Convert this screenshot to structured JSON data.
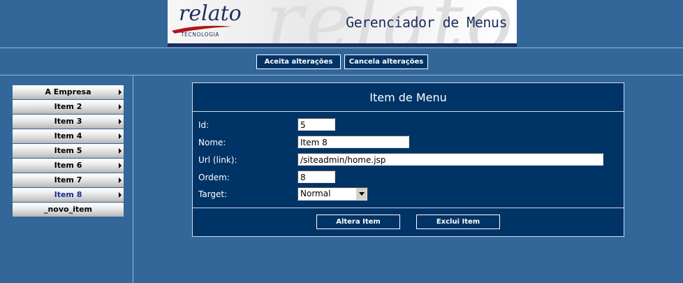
{
  "header": {
    "logo_text": "relato",
    "logo_subtext": "TECNOLOGIA",
    "watermark": "relato",
    "app_title": "Gerenciador de Menus"
  },
  "toolbar": {
    "accept_label": "Aceita alterações",
    "cancel_label": "Cancela alterações"
  },
  "sidebar": {
    "items": [
      {
        "label": "A Empresa"
      },
      {
        "label": "Item 2"
      },
      {
        "label": "Item 3"
      },
      {
        "label": "Item 4"
      },
      {
        "label": "Item 5"
      },
      {
        "label": "Item 6"
      },
      {
        "label": "Item 7"
      },
      {
        "label": "Item 8",
        "selected": true
      },
      {
        "label": "_novo_item"
      }
    ]
  },
  "form": {
    "title": "Item de Menu",
    "fields": {
      "id": {
        "label": "Id:",
        "value": "5"
      },
      "nome": {
        "label": "Nome:",
        "value": "Item 8"
      },
      "url": {
        "label": "Url (link):",
        "value": "/siteadmin/home.jsp"
      },
      "ordem": {
        "label": "Ordem:",
        "value": "8"
      },
      "target": {
        "label": "Target:",
        "value": "Normal"
      }
    },
    "alter_label": "Altera Item",
    "delete_label": "Exclui Item"
  },
  "colors": {
    "background": "#336699",
    "panel": "#003366",
    "header_text": "#1d2f5e",
    "selected_item": "#1c2a8f"
  }
}
